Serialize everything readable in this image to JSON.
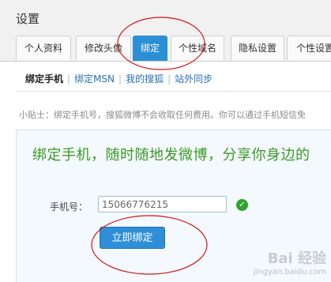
{
  "page": {
    "title": "设置"
  },
  "tabs": [
    {
      "label": "个人资料",
      "active": false
    },
    {
      "label": "修改头像",
      "active": false
    },
    {
      "label": "绑定",
      "active": true
    },
    {
      "label": "个性域名",
      "active": false
    },
    {
      "label": "隐私设置",
      "active": false
    },
    {
      "label": "个性设置",
      "active": false
    }
  ],
  "subnav": {
    "items": [
      {
        "label": "绑定手机",
        "active": true
      },
      {
        "label": "绑定MSN",
        "active": false
      },
      {
        "label": "我的搜狐",
        "active": false
      },
      {
        "label": "站外同步",
        "active": false
      }
    ],
    "separator": "|"
  },
  "tip": "小贴士：绑定手机号，搜狐微博不会收取任何费用。你可以通过手机短信免",
  "panel": {
    "banner": "绑定手机，随时随地发微博，分享你身边的",
    "phone_label": "手机号：",
    "phone_value": "15066776215",
    "bind_button": "立即绑定"
  },
  "icons": {
    "valid": "check-circle-icon"
  },
  "colors": {
    "accent": "#2b8fd6",
    "banner": "#3a9a26",
    "valid": "#2fa32f",
    "annotation": "#d8141a"
  },
  "watermark": {
    "logo": "Bai 经验",
    "url": "jingyan.baidu.com"
  }
}
